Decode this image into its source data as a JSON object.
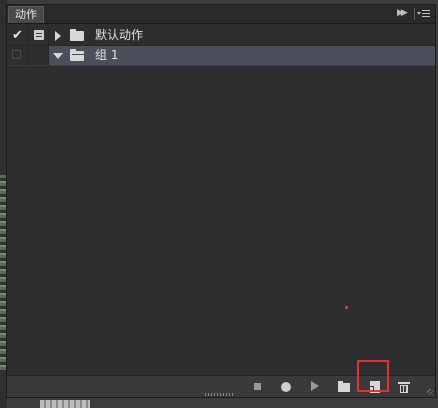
{
  "panel": {
    "tab_label": "动作",
    "collapse_icon": "double-chevron-right-icon",
    "menu_icon": "panel-menu-icon"
  },
  "actions": [
    {
      "label": "默认动作",
      "checked": true,
      "has_dialog": true,
      "expanded": false,
      "selected": false
    },
    {
      "label": "组 1",
      "checked": false,
      "has_dialog": false,
      "expanded": true,
      "selected": true
    }
  ],
  "toolbar": {
    "buttons": [
      "stop-icon",
      "record-icon",
      "play-icon",
      "folder-icon",
      "new-action-icon",
      "trash-icon"
    ],
    "highlighted": "new-action-icon"
  },
  "colors": {
    "selection": "#4b4f5b",
    "highlight": "#e53030"
  }
}
